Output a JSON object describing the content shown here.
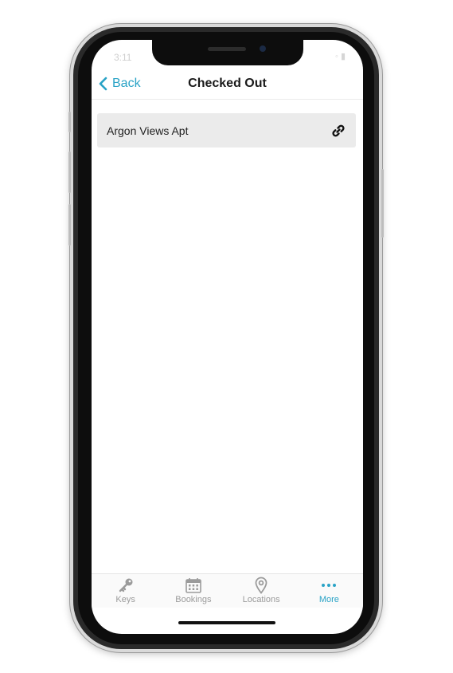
{
  "status_bar": {
    "time": "3:11",
    "icons": "◦ ▮"
  },
  "navbar": {
    "back_label": "Back",
    "title": "Checked Out"
  },
  "list": {
    "items": [
      {
        "label": "Argon Views Apt"
      }
    ]
  },
  "tabbar": {
    "tabs": [
      {
        "label": "Keys",
        "icon": "key-icon",
        "active": false
      },
      {
        "label": "Bookings",
        "icon": "calendar-icon",
        "active": false
      },
      {
        "label": "Locations",
        "icon": "location-pin-icon",
        "active": false
      },
      {
        "label": "More",
        "icon": "more-dots-icon",
        "active": true
      }
    ]
  },
  "colors": {
    "accent": "#2aa3c6",
    "inactive": "#9b9b9b",
    "row_bg": "#ebebeb"
  }
}
